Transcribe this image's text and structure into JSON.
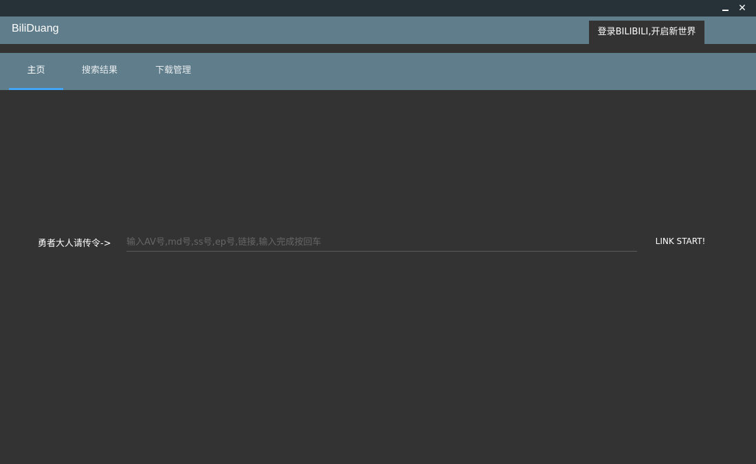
{
  "window": {
    "minimize_icon": "minimize-icon",
    "close_icon": "close-icon",
    "close_glyph": "✕"
  },
  "appbar": {
    "title": "BiliDuang",
    "login_label": "登录BILIBILI,开启新世界"
  },
  "tabs": [
    {
      "label": "主页",
      "active": true
    },
    {
      "label": "搜索结果",
      "active": false
    },
    {
      "label": "下载管理",
      "active": false
    }
  ],
  "main": {
    "command_label": "勇者大人请传令->",
    "command_placeholder": "输入AV号,md号,ss号,ep号,链接,输入完成按回车",
    "command_value": "",
    "submit_label": "LINK START!"
  },
  "colors": {
    "titlebar": "#263238",
    "appbar": "#607d8b",
    "background": "#333333",
    "tab_indicator": "#42a5f5"
  }
}
